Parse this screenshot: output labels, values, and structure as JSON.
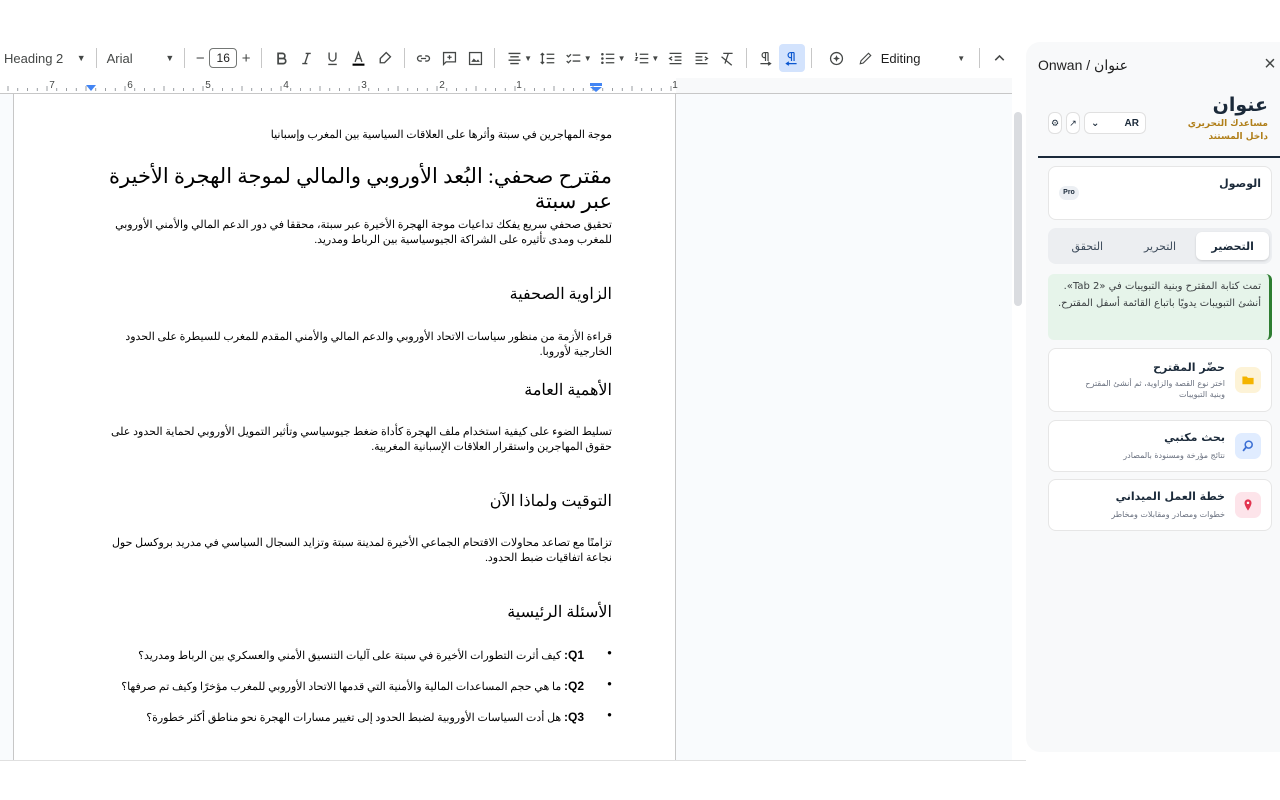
{
  "toolbar": {
    "style": "Heading 2",
    "font": "Arial",
    "font_size": "16",
    "minus": "−",
    "plus": "+",
    "mode": "Editing"
  },
  "ruler": {
    "numbers": [
      "7",
      "6",
      "5",
      "4",
      "3",
      "2",
      "1",
      "1"
    ]
  },
  "document": {
    "subtitle": "موجة المهاجرين في سبتة وأثرها على العلاقات السياسية بين المغرب وإسبانيا",
    "title": "مقترح صحفي: البُعد الأوروبي والمالي لموجة الهجرة الأخيرة عبر سبتة",
    "intro": "تحقيق صحفي سريع يفكك تداعيات موجة الهجرة الأخيرة عبر سبتة، محققا في دور الدعم المالي والأمني الأوروبي للمغرب ومدى تأثيره على الشراكة الجيوسياسية بين الرباط ومدريد.",
    "sections": [
      {
        "heading": "الزاوية الصحفية",
        "body": "قراءة الأزمة من منظور سياسات الاتحاد الأوروبي والدعم المالي والأمني المقدم للمغرب للسيطرة على الحدود الخارجية لأوروبا."
      },
      {
        "heading": "الأهمية العامة",
        "body": "تسليط الضوء على كيفية استخدام ملف الهجرة كأداة ضغط جيوسياسي وتأثير التمويل الأوروبي لحماية الحدود على حقوق المهاجرين واستقرار العلاقات الإسبانية المغربية."
      },
      {
        "heading": "التوقيت ولماذا الآن",
        "body": "تزامنًا مع تصاعد محاولات الاقتحام الجماعي الأخيرة لمدينة سبتة وتزايد السجال السياسي في مدريد بروكسل حول نجاعة اتفاقيات ضبط الحدود."
      }
    ],
    "questions_heading": "الأسئلة الرئيسية",
    "questions": [
      {
        "label": "Q1:",
        "text": "كيف أثرت التطورات الأخيرة في سبتة على آليات التنسيق الأمني والعسكري بين الرباط ومدريد؟"
      },
      {
        "label": "Q2:",
        "text": "ما هي حجم المساعدات المالية والأمنية التي قدمها الاتحاد الأوروبي للمغرب مؤخرًا وكيف تم صرفها؟"
      },
      {
        "label": "Q3:",
        "text": "هل أدت السياسات الأوروبية لضبط الحدود إلى تغيير مسارات الهجرة نحو مناطق أكثر خطورة؟"
      }
    ]
  },
  "panel": {
    "title": "Onwan / عنوان",
    "brand_name": "عنوان",
    "brand_tagline": "مساعدك التحريري داخل المستند",
    "language": "AR",
    "access_title": "الوصول",
    "pro_badge": "Pro",
    "tabs": [
      "التحضير",
      "التحرير",
      "التحقق"
    ],
    "active_tab": "التحضير",
    "note": "تمت كتابة المقترح وبنية التبويبات في «Tab 2». أنشئ التبويبات يدويًا باتباع القائمة أسفل المقترح.",
    "tools": [
      {
        "title": "حضّر المقترح",
        "desc": "اختر نوع القصة والزاوية، ثم أنشئ المقترح وبنية التبويبات",
        "icon": "folder-icon",
        "color": "#fdf3d7"
      },
      {
        "title": "بحث مكتبي",
        "desc": "نتائج مؤرخة ومسنودة بالمصادر",
        "icon": "magnifier-icon",
        "color": "#e0ecff"
      },
      {
        "title": "خطة العمل الميداني",
        "desc": "خطوات ومصادر ومقابلات ومخاطر",
        "icon": "pin-icon",
        "color": "#fde4ea"
      }
    ],
    "colors": {
      "brand": "#1b2a3a",
      "accent": "#b07f1a",
      "note_bg": "#e6f4ea",
      "note_border": "#2e7d32"
    }
  }
}
